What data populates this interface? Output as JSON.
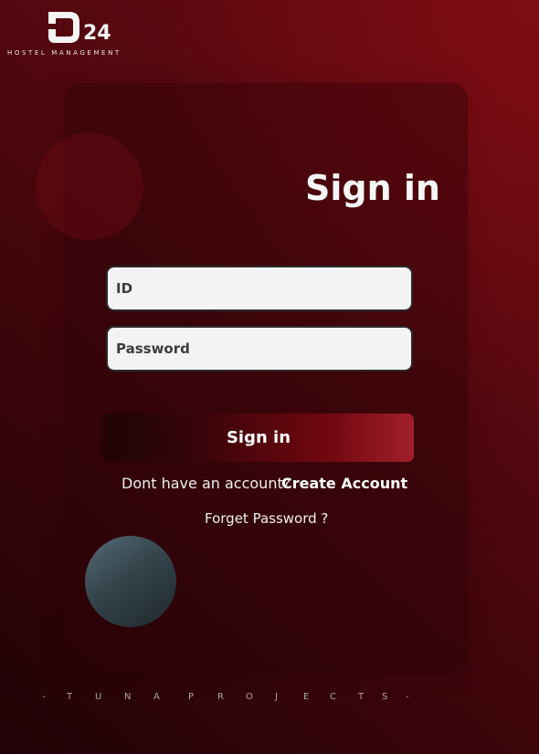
{
  "brand": {
    "logo_letter": "D",
    "logo_number": "24",
    "subtitle": "HOSTEL MANAGEMENT"
  },
  "form": {
    "title": "Sign in",
    "id_placeholder": "ID",
    "password_placeholder": "Password",
    "submit_label": "Sign in"
  },
  "links": {
    "account_prompt": "Dont have an account?",
    "create_account": "Create Account",
    "forget_password": "Forget Password ?"
  },
  "footer": {
    "credit_chars": [
      "-",
      "T",
      "U",
      "N",
      "A",
      "P",
      "R",
      "O",
      "J",
      "E",
      "C",
      "T",
      "S",
      "-"
    ]
  },
  "colors": {
    "background_dark": "#200206",
    "background_accent": "#7e0c13",
    "input_background": "#f3f3f3",
    "button_accent": "#a11f2a",
    "orb": "#556b75"
  }
}
